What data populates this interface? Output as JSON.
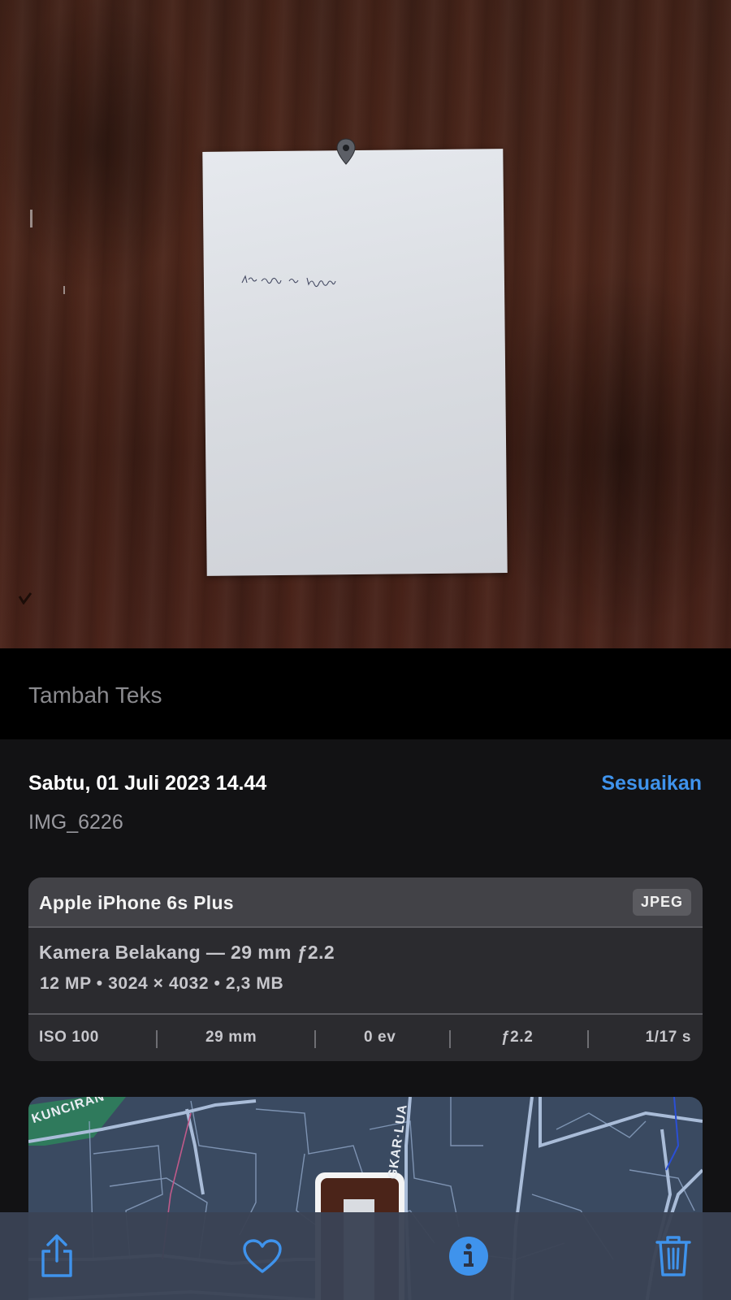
{
  "photo": {
    "description_icon": "location-pin-icon",
    "paper_handwriting": "Nur Aisyah Fadilah"
  },
  "caption": {
    "placeholder": "Tambah Teks"
  },
  "info": {
    "date": "Sabtu, 01 Juli 2023 14.44",
    "adjust_label": "Sesuaikan",
    "filename": "IMG_6226"
  },
  "camera": {
    "device": "Apple iPhone 6s Plus",
    "format": "JPEG",
    "lens": "Kamera Belakang — 29 mm ƒ2.2",
    "specs": "12 MP  •  3024 × 4032  •  2,3 MB",
    "exif": {
      "iso": "ISO 100",
      "focal": "29 mm",
      "ev": "0 ev",
      "aperture": "ƒ2.2",
      "shutter": "1/17 s"
    }
  },
  "map": {
    "road_labels": [
      "KUNCIRAN–C",
      "GKAR·LUA"
    ]
  },
  "toolbar": {
    "icons": [
      "share-icon",
      "heart-icon",
      "info-icon",
      "trash-icon"
    ],
    "accent": "#3f93ec"
  }
}
